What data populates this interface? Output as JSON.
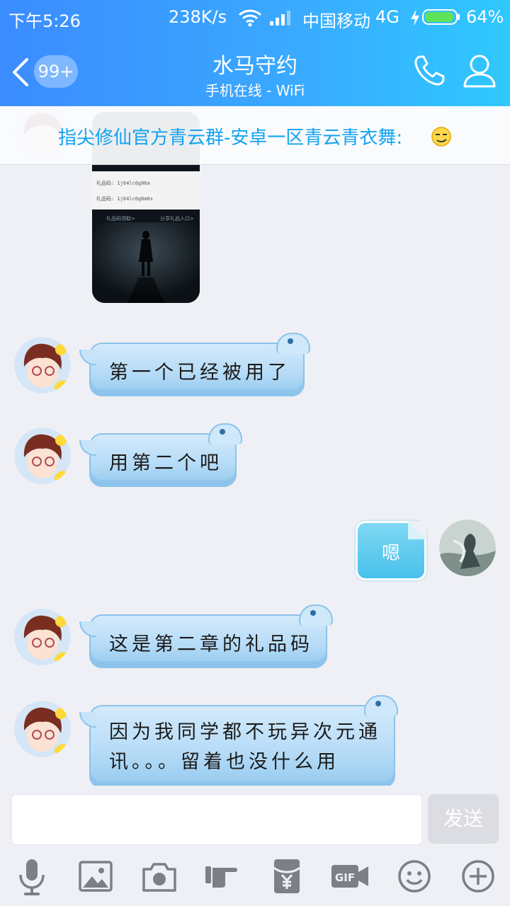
{
  "status_bar": {
    "time": "下午5:26",
    "speed": "238K/s",
    "carrier": "中国移动",
    "network": "4G",
    "battery": "64%",
    "battery_level": 0.64
  },
  "header": {
    "unread_badge": "99+",
    "title": "水马守约",
    "subtitle": "手机在线 - WiFi"
  },
  "announcement": {
    "text": "指尖修仙官方青云群-安卓一区青云青衣舞:"
  },
  "image_message": {
    "lines": [
      "礼品码: 1j64lc6g06a",
      "礼品码: 1j64lc6g6m0s"
    ],
    "links": [
      "礼品码领取>",
      "分享礼品入口>"
    ]
  },
  "messages": [
    {
      "direction": "in",
      "text": "第一个已经被用了"
    },
    {
      "direction": "in",
      "text": "用第二个吧"
    },
    {
      "direction": "out",
      "text": "嗯"
    },
    {
      "direction": "in",
      "text": "这是第二章的礼品码"
    },
    {
      "direction": "in",
      "lines": [
        "因为我同学都不玩异次元通",
        "讯。。。留着也没什么用"
      ]
    }
  ],
  "composer": {
    "input_value": "",
    "send_label": "发送"
  },
  "toolbar": {
    "icons": [
      "microphone-icon",
      "image-icon",
      "camera-icon",
      "poke-hand-icon",
      "red-packet-icon",
      "gif-icon",
      "emoji-icon",
      "plus-icon"
    ]
  },
  "colors": {
    "header_gradient": [
      "#3b8cff",
      "#2fc8ff"
    ],
    "announcement_text": "#13a2f0",
    "bubble_in": "#b7dcf7",
    "bubble_out": "#48c0ec",
    "send_disabled": "#dcdde2"
  }
}
